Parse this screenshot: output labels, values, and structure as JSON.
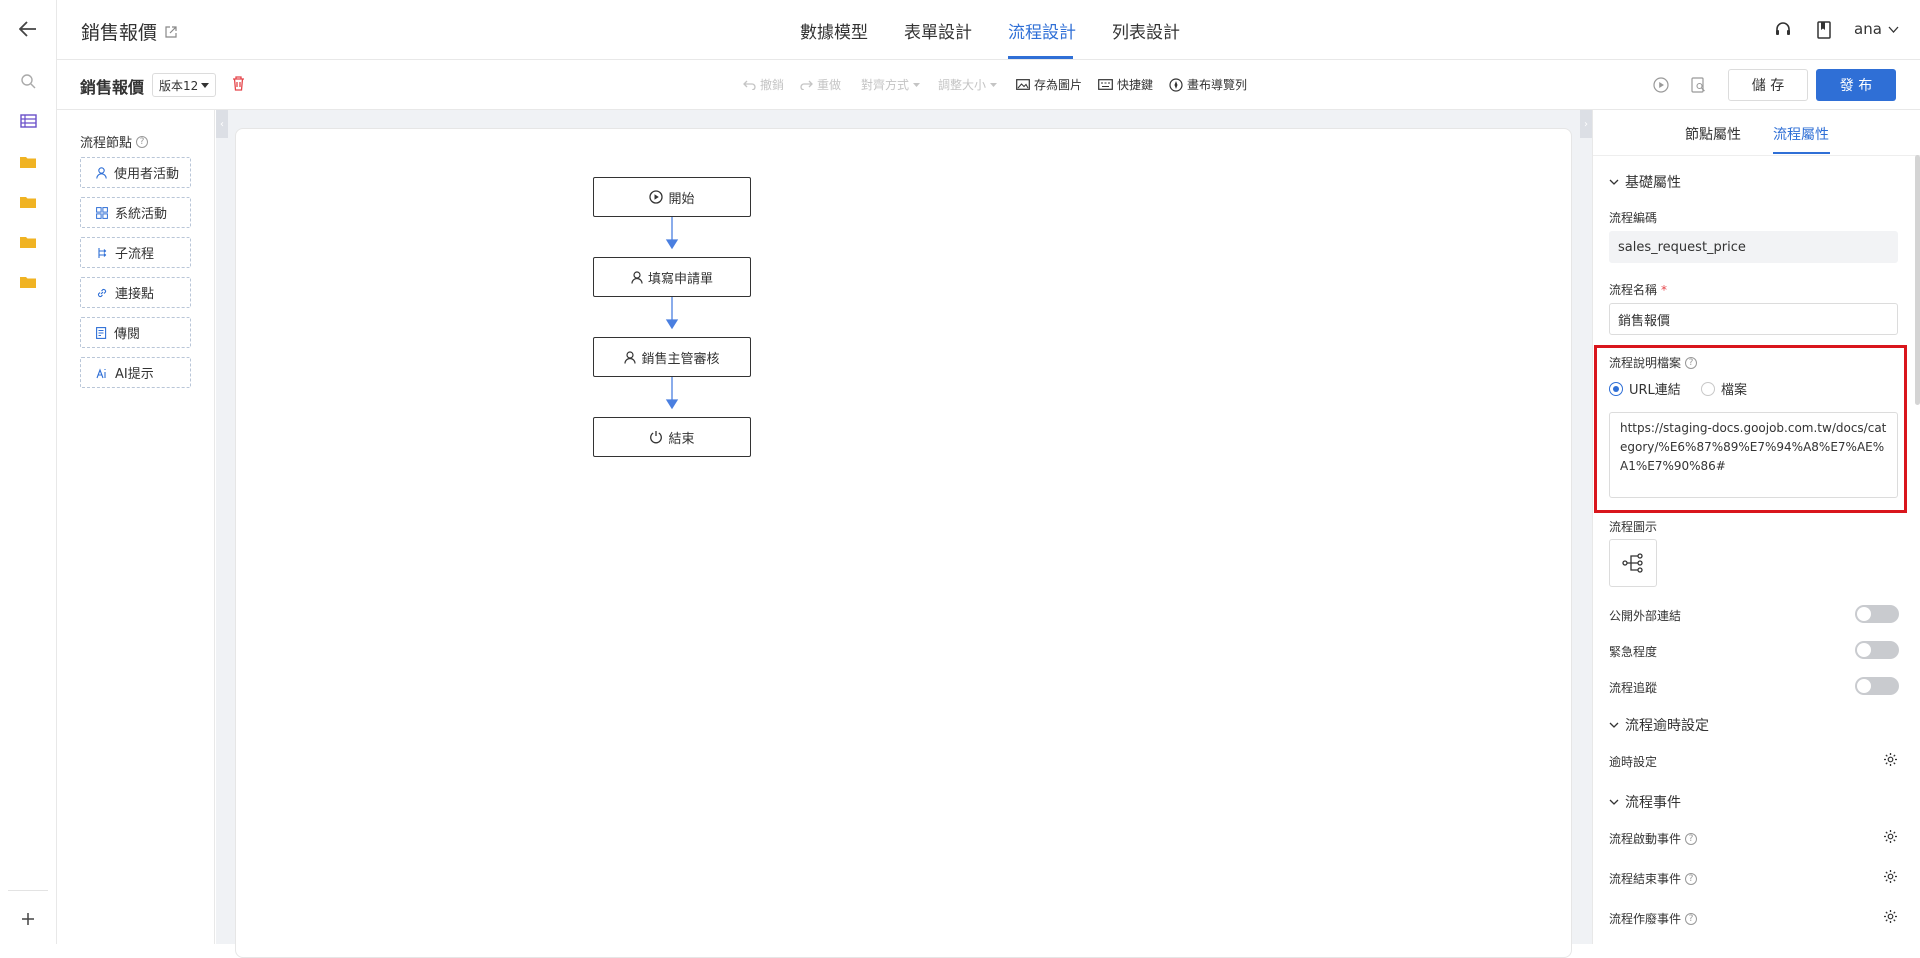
{
  "header": {
    "app_title": "銷售報價",
    "tabs": [
      "數據模型",
      "表單設計",
      "流程設計",
      "列表設計"
    ],
    "active_tab": "流程設計",
    "user": "ana"
  },
  "toolbar": {
    "flow_name": "銷售報價",
    "version": "版本12",
    "undo": "撤銷",
    "redo": "重做",
    "align": "對齊方式",
    "resize": "調整大小",
    "save_image": "存為圖片",
    "shortcut": "快捷鍵",
    "canvas_nav": "畫布導覽列",
    "save": "儲 存",
    "publish": "發 布"
  },
  "palette": {
    "title": "流程節點",
    "items": [
      {
        "label": "使用者活動",
        "icon": "user-icon"
      },
      {
        "label": "系統活動",
        "icon": "grid-icon"
      },
      {
        "label": "子流程",
        "icon": "subprocess-icon"
      },
      {
        "label": "連接點",
        "icon": "link-icon"
      },
      {
        "label": "傳閱",
        "icon": "document-icon"
      },
      {
        "label": "AI提示",
        "icon": "ai-icon"
      }
    ]
  },
  "flow": {
    "nodes": [
      {
        "label": "開始",
        "icon": "play-icon"
      },
      {
        "label": "填寫申請單",
        "icon": "user-icon"
      },
      {
        "label": "銷售主管審核",
        "icon": "user-icon"
      },
      {
        "label": "結束",
        "icon": "power-icon"
      }
    ]
  },
  "props": {
    "tab_node": "節點屬性",
    "tab_flow": "流程屬性",
    "section_basic": "基礎屬性",
    "code_label": "流程編碼",
    "code_value": "sales_request_price",
    "name_label": "流程名稱",
    "name_required": "*",
    "name_value": "銷售報價",
    "doc_label": "流程說明檔案",
    "radio_url": "URL連結",
    "radio_file": "檔案",
    "url_value": "https://staging-docs.goojob.com.tw/docs/category/%E6%87%89%E7%94%A8%E7%AE%A1%E7%90%86#",
    "icon_label": "流程圖示",
    "public_link": "公開外部連結",
    "urgency": "緊急程度",
    "tracking": "流程追蹤",
    "section_timeout": "流程逾時設定",
    "timeout_setting": "逾時設定",
    "section_events": "流程事件",
    "event_start": "流程啟動事件",
    "event_end": "流程結束事件",
    "event_void": "流程作廢事件",
    "highlight_color": "#d9161c",
    "accent_color": "#2f6fd6"
  }
}
